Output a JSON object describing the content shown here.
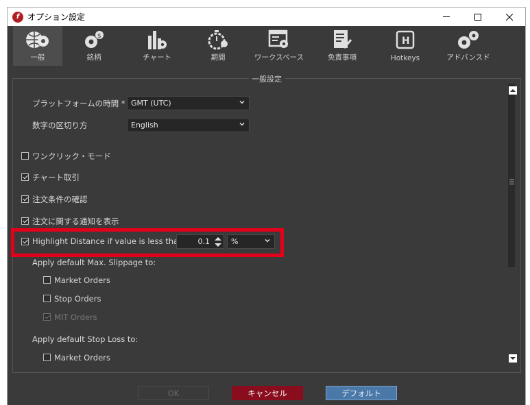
{
  "window": {
    "title": "オプション設定",
    "minimize": "—",
    "maximize": "☐",
    "close": "✕"
  },
  "tabs": [
    {
      "label": "一般",
      "icon": "globe-gear-icon",
      "active": true
    },
    {
      "label": "銘柄",
      "icon": "gear-dollar-icon"
    },
    {
      "label": "チャート",
      "icon": "chart-gear-icon"
    },
    {
      "label": "期間",
      "icon": "stopwatch-icon"
    },
    {
      "label": "ワークスペース",
      "icon": "window-gear-icon"
    },
    {
      "label": "免責事項",
      "icon": "document-pen-icon"
    },
    {
      "label": "Hotkeys",
      "icon": "hotkey-h-icon"
    },
    {
      "label": "アドバンスド",
      "icon": "gears-icon"
    }
  ],
  "panel": {
    "title": "一般設定",
    "platform_time_label": "プラットフォームの時間 *",
    "platform_time_value": "GMT (UTC)",
    "number_separator_label": "数字の区切り方",
    "number_separator_value": "English",
    "checkboxes": {
      "one_click": {
        "label": "ワンクリック・モード",
        "checked": false
      },
      "chart_trading": {
        "label": "チャート取引",
        "checked": true
      },
      "order_confirm": {
        "label": "注文条件の確認",
        "checked": true
      },
      "order_notify": {
        "label": "注文に関する通知を表示",
        "checked": true
      },
      "highlight_distance": {
        "label": "Highlight Distance if value is less than",
        "checked": true
      }
    },
    "highlight_value": "0.1",
    "highlight_unit": "%",
    "slippage_heading": "Apply default Max. Slippage to:",
    "slippage_market": {
      "label": "Market Orders",
      "checked": false
    },
    "slippage_stop": {
      "label": "Stop Orders",
      "checked": false
    },
    "slippage_mit": {
      "label": "MIT Orders",
      "checked": true,
      "disabled": true
    },
    "stoploss_heading": "Apply default Stop Loss to:",
    "stoploss_market": {
      "label": "Market Orders",
      "checked": false
    }
  },
  "footer": {
    "ok": "OK",
    "cancel": "キャンセル",
    "default": "デフォルト"
  },
  "colors": {
    "background": "#3a3a3a",
    "cancel": "#8a0d1d",
    "default": "#4a78a8",
    "highlight": "#e3001b"
  }
}
